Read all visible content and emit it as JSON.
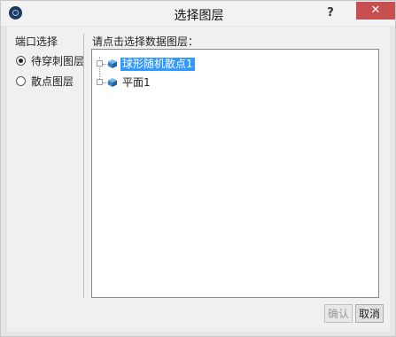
{
  "window": {
    "title": "选择图层",
    "help": "?",
    "close": "✕"
  },
  "left_panel": {
    "group_title": "端口选择",
    "options": [
      {
        "label": "待穿刺图层",
        "checked": true
      },
      {
        "label": "散点图层",
        "checked": false
      }
    ]
  },
  "tree_panel": {
    "title": "请点击选择数据图层：",
    "items": [
      {
        "label": "球形随机散点1",
        "selected": true
      },
      {
        "label": "平面1",
        "selected": false
      }
    ]
  },
  "buttons": {
    "confirm": "确认",
    "cancel": "取消"
  },
  "colors": {
    "selection": "#3399ff",
    "close": "#c74f4f",
    "cube": "#3b82c4"
  }
}
